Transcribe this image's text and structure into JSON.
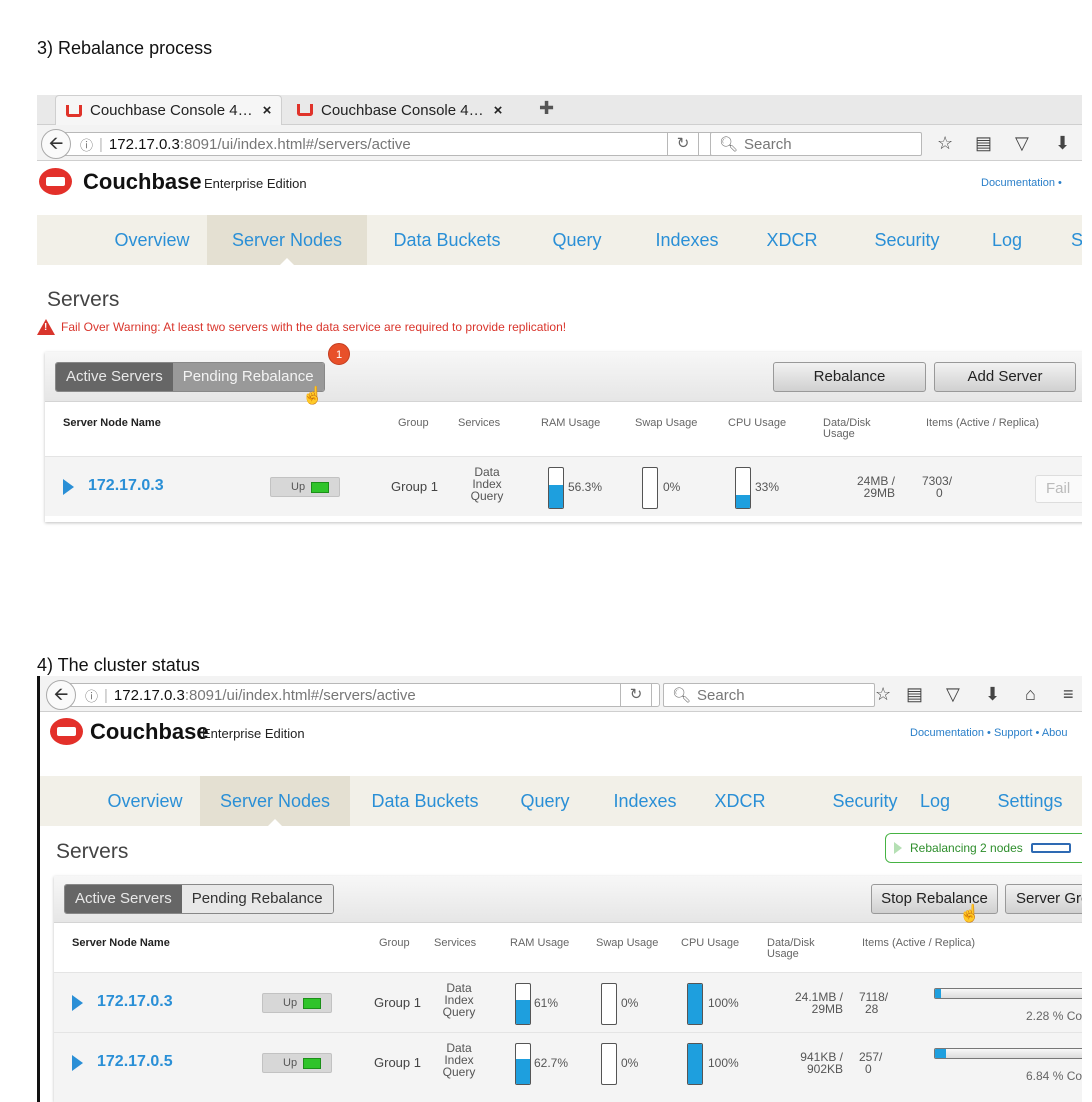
{
  "step3": {
    "caption": "3) Rebalance process",
    "tabs": [
      "Couchbase Console 4…",
      "Couchbase Console 4…"
    ],
    "url": {
      "host": "172.17.0.3",
      "path": ":8091/ui/index.html#/servers/active"
    },
    "search_placeholder": "Search",
    "brand": "Couchbase",
    "edition": "Enterprise Edition",
    "header_links": "Documentation  •",
    "nav": [
      "Overview",
      "Server Nodes",
      "Data Buckets",
      "Query",
      "Indexes",
      "XDCR",
      "Security",
      "Log",
      "S"
    ],
    "page_title": "Servers",
    "warning": "Fail Over Warning: At least two servers with the data service are required to provide replication!",
    "seg_active": "Active Servers",
    "seg_pending": "Pending Rebalance",
    "pending_badge": "1",
    "btn_rebalance": "Rebalance",
    "btn_add_server": "Add Server",
    "columns": {
      "name": "Server Node Name",
      "group": "Group",
      "services": "Services",
      "ram": "RAM Usage",
      "swap": "Swap Usage",
      "cpu": "CPU Usage",
      "disk1": "Data/Disk",
      "disk2": "Usage",
      "items": "Items (Active / Replica)"
    },
    "row": {
      "host": "172.17.0.3",
      "status": "Up",
      "group": "Group 1",
      "services": [
        "Data",
        "Index",
        "Query"
      ],
      "ram": "56.3%",
      "ram_fill": 0.563,
      "swap": "0%",
      "swap_fill": 0,
      "cpu": "33%",
      "cpu_fill": 0.33,
      "disk1": "24MB /",
      "disk2": "29MB",
      "items1": "7303/",
      "items2": "0",
      "fail_btn": "Fail"
    }
  },
  "step4": {
    "caption": "4) The cluster status",
    "url": {
      "host": "172.17.0.3",
      "path": ":8091/ui/index.html#/servers/active"
    },
    "search_placeholder": "Search",
    "brand": "Couchbase",
    "edition": "Enterprise Edition",
    "header_links": "Documentation  •  Support  •  Abou",
    "nav": [
      "Overview",
      "Server Nodes",
      "Data Buckets",
      "Query",
      "Indexes",
      "XDCR",
      "Security",
      "Log",
      "Settings"
    ],
    "page_title": "Servers",
    "rebalancing_status": "Rebalancing 2 nodes",
    "seg_active": "Active Servers",
    "seg_pending": "Pending Rebalance",
    "btn_stop": "Stop Rebalance",
    "btn_groups": "Server Gro",
    "columns": {
      "name": "Server Node Name",
      "group": "Group",
      "services": "Services",
      "ram": "RAM Usage",
      "swap": "Swap Usage",
      "cpu": "CPU Usage",
      "disk1": "Data/Disk",
      "disk2": "Usage",
      "items": "Items (Active / Replica)"
    },
    "rows": [
      {
        "host": "172.17.0.3",
        "status": "Up",
        "group": "Group 1",
        "services": [
          "Data",
          "Index",
          "Query"
        ],
        "ram": "61%",
        "ram_fill": 0.61,
        "swap": "0%",
        "swap_fill": 0,
        "cpu": "100%",
        "cpu_fill": 1.0,
        "disk1": "24.1MB /",
        "disk2": "29MB",
        "items1": "7118/",
        "items2": "28",
        "progress": 0.0228,
        "progress_label": "2.28 % Co"
      },
      {
        "host": "172.17.0.5",
        "status": "Up",
        "group": "Group 1",
        "services": [
          "Data",
          "Index",
          "Query"
        ],
        "ram": "62.7%",
        "ram_fill": 0.627,
        "swap": "0%",
        "swap_fill": 0,
        "cpu": "100%",
        "cpu_fill": 1.0,
        "disk1": "941KB /",
        "disk2": "902KB",
        "items1": "257/",
        "items2": "0",
        "progress": 0.0684,
        "progress_label": "6.84 % Co"
      }
    ]
  }
}
